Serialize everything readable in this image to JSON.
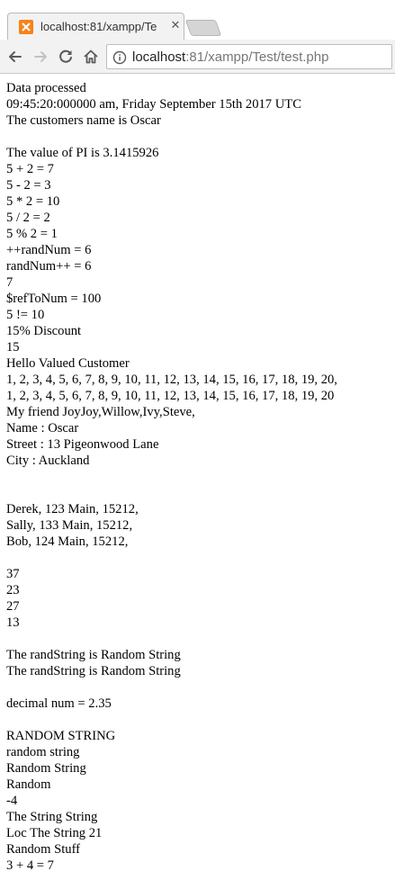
{
  "browser": {
    "tab_title": "localhost:81/xampp/Te",
    "url_host": "localhost",
    "url_rest": ":81/xampp/Test/test.php"
  },
  "page": {
    "lines": [
      "Data processed",
      "09:45:20:000000 am, Friday September 15th 2017 UTC",
      "The customers name is Oscar",
      "",
      "The value of PI is 3.1415926",
      "5 + 2 = 7",
      "5 - 2 = 3",
      "5 * 2 = 10",
      "5 / 2 = 2",
      "5 % 2 = 1",
      "++randNum = 6",
      "randNum++ = 6",
      "7",
      "$refToNum = 100",
      "5 != 10",
      "15% Discount",
      "15",
      "Hello Valued Customer",
      "1, 2, 3, 4, 5, 6, 7, 8, 9, 10, 11, 12, 13, 14, 15, 16, 17, 18, 19, 20,",
      "1, 2, 3, 4, 5, 6, 7, 8, 9, 10, 11, 12, 13, 14, 15, 16, 17, 18, 19, 20",
      "My friend JoyJoy,Willow,Ivy,Steve,",
      "Name : Oscar",
      "Street : 13 Pigeonwood Lane",
      "City : Auckland",
      "",
      "",
      "Derek, 123 Main, 15212,",
      "Sally, 133 Main, 15212,",
      "Bob, 124 Main, 15212,",
      "",
      "37",
      "23",
      "27",
      "13",
      "",
      "The randString is Random String",
      "The randString is Random String",
      "",
      "decimal num = 2.35",
      "",
      "RANDOM STRING",
      "random string",
      "Random String",
      "Random",
      "-4",
      "The String String",
      "Loc The String 21",
      "Random Stuff",
      "3 + 4 = 7"
    ]
  }
}
